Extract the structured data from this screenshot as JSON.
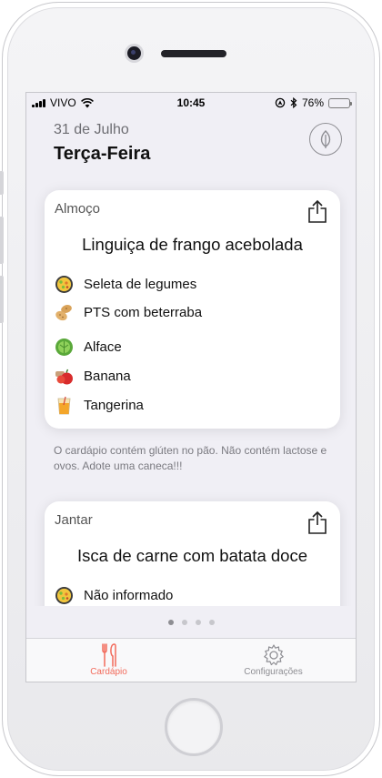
{
  "status": {
    "carrier": "VIVO",
    "time": "10:45",
    "battery": "76%",
    "battery_level": 0.76
  },
  "header": {
    "date": "31 de Julho",
    "weekday": "Terça-Feira"
  },
  "cards": [
    {
      "meal": "Almoço",
      "dish": "Linguiça de frango acebolada",
      "items": [
        {
          "icon": "salad-bowl-icon",
          "label": "Seleta de legumes"
        },
        {
          "icon": "potatoes-icon",
          "label": "PTS com beterraba"
        },
        {
          "icon": "lettuce-icon",
          "label": "Alface"
        },
        {
          "icon": "fruit-icon",
          "label": "Banana"
        },
        {
          "icon": "juice-icon",
          "label": "Tangerina"
        }
      ]
    },
    {
      "meal": "Jantar",
      "dish": "Isca de carne com batata doce",
      "items": [
        {
          "icon": "salad-bowl-icon",
          "label": "Não informado"
        }
      ]
    }
  ],
  "note": "O cardápio contém glúten no pão. Não contém lactose e ovos. Adote uma caneca!!!",
  "tabs": {
    "menu": "Cardápio",
    "settings": "Configurações"
  },
  "colors": {
    "accent": "#f26b5b",
    "inactive": "#8e8e93",
    "background": "#f0eff5"
  },
  "page_control": {
    "total": 4,
    "current": 1
  }
}
